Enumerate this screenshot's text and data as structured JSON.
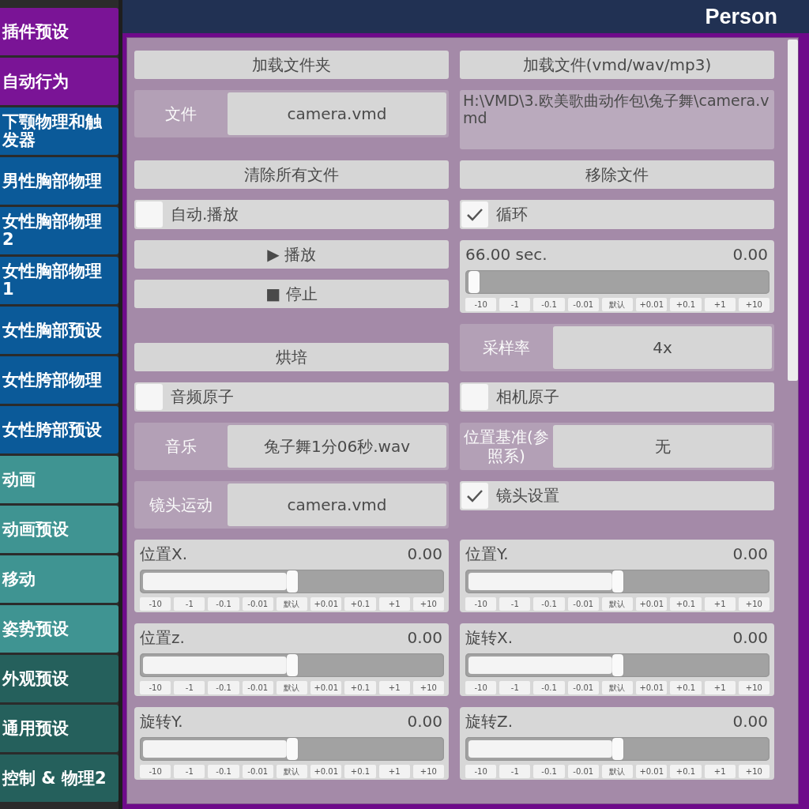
{
  "sidebar": {
    "items": [
      {
        "label": "插件预设",
        "color": "#7a1496"
      },
      {
        "label": "自动行为",
        "color": "#7a1496"
      },
      {
        "label": "下颚物理和触发器",
        "color": "#0b5a99"
      },
      {
        "label": "男性胸部物理",
        "color": "#0b5a99"
      },
      {
        "label": "女性胸部物理2",
        "color": "#0b5a99"
      },
      {
        "label": "女性胸部物理1",
        "color": "#0b5a99"
      },
      {
        "label": "女性胸部预设",
        "color": "#0b5a99"
      },
      {
        "label": "女性胯部物理",
        "color": "#0b5a99"
      },
      {
        "label": "女性胯部预设",
        "color": "#0b5a99"
      },
      {
        "label": "动画",
        "color": "#3f9492"
      },
      {
        "label": "动画预设",
        "color": "#3f9492"
      },
      {
        "label": "移动",
        "color": "#3f9492"
      },
      {
        "label": "姿势预设",
        "color": "#3f9492"
      },
      {
        "label": "外观预设",
        "color": "#25605c"
      },
      {
        "label": "通用预设",
        "color": "#25605c"
      },
      {
        "label": "控制 & 物理2",
        "color": "#25605c"
      }
    ]
  },
  "header": {
    "title": "Person"
  },
  "rows": [
    {
      "left": {
        "kind": "button",
        "label": "加载文件夹"
      },
      "right": {
        "kind": "button",
        "label": "加载文件(vmd/wav/mp3)"
      }
    },
    {
      "left": {
        "kind": "field",
        "label": "文件",
        "value": "camera.vmd"
      },
      "right": {
        "kind": "path",
        "text": "H:\\VMD\\3.欧美歌曲动作包\\兔子舞\\camera.vmd"
      }
    },
    {
      "left": {
        "kind": "button",
        "label": "清除所有文件"
      },
      "right": {
        "kind": "button",
        "label": "移除文件"
      }
    },
    {
      "left": {
        "kind": "checkbox",
        "label": "自动.播放",
        "checked": false
      },
      "right": {
        "kind": "checkbox",
        "label": "循环",
        "checked": true
      }
    },
    {
      "left": {
        "kind": "buttons",
        "labels": [
          "▶ 播放",
          "■ 停止"
        ]
      },
      "right": {
        "kind": "slider",
        "label": "66.00 sec.",
        "value": "0.00",
        "level": 0,
        "steps": [
          "-10",
          "-1",
          "-0.1",
          "-0.01",
          "默认",
          "+0.01",
          "+0.1",
          "+1",
          "+10"
        ]
      }
    },
    {
      "left": {
        "kind": "button",
        "label": "烘培"
      },
      "right": {
        "kind": "field",
        "label": "采样率",
        "value": "4x"
      }
    },
    {
      "left": {
        "kind": "checkbox",
        "label": "音频原子",
        "checked": false
      },
      "right": {
        "kind": "checkbox",
        "label": "相机原子",
        "checked": false
      }
    },
    {
      "left": {
        "kind": "field",
        "label": "音乐",
        "value": "兔子舞1分06秒.wav"
      },
      "right": {
        "kind": "field",
        "label": "位置基准(参照系)",
        "value": "无"
      }
    },
    {
      "left": {
        "kind": "field",
        "label": "镜头运动",
        "value": "camera.vmd"
      },
      "right": {
        "kind": "checkbox",
        "label": "镜头设置",
        "checked": true
      }
    },
    {
      "left": {
        "kind": "slider",
        "label": "位置X.",
        "value": "0.00",
        "level": 0.5,
        "steps": [
          "-10",
          "-1",
          "-0.1",
          "-0.01",
          "默认",
          "+0.01",
          "+0.1",
          "+1",
          "+10"
        ]
      },
      "right": {
        "kind": "slider",
        "label": "位置Y.",
        "value": "0.00",
        "level": 0.5,
        "steps": [
          "-10",
          "-1",
          "-0.1",
          "-0.01",
          "默认",
          "+0.01",
          "+0.1",
          "+1",
          "+10"
        ]
      }
    },
    {
      "left": {
        "kind": "slider",
        "label": "位置z.",
        "value": "0.00",
        "level": 0.5,
        "steps": [
          "-10",
          "-1",
          "-0.1",
          "-0.01",
          "默认",
          "+0.01",
          "+0.1",
          "+1",
          "+10"
        ]
      },
      "right": {
        "kind": "slider",
        "label": "旋转X.",
        "value": "0.00",
        "level": 0.5,
        "steps": [
          "-10",
          "-1",
          "-0.1",
          "-0.01",
          "默认",
          "+0.01",
          "+0.1",
          "+1",
          "+10"
        ]
      }
    },
    {
      "left": {
        "kind": "slider",
        "label": "旋转Y.",
        "value": "0.00",
        "level": 0.5,
        "steps": [
          "-10",
          "-1",
          "-0.1",
          "-0.01",
          "默认",
          "+0.01",
          "+0.1",
          "+1",
          "+10"
        ]
      },
      "right": {
        "kind": "slider",
        "label": "旋转Z.",
        "value": "0.00",
        "level": 0.5,
        "steps": [
          "-10",
          "-1",
          "-0.1",
          "-0.01",
          "默认",
          "+0.01",
          "+0.1",
          "+1",
          "+10"
        ]
      }
    }
  ]
}
